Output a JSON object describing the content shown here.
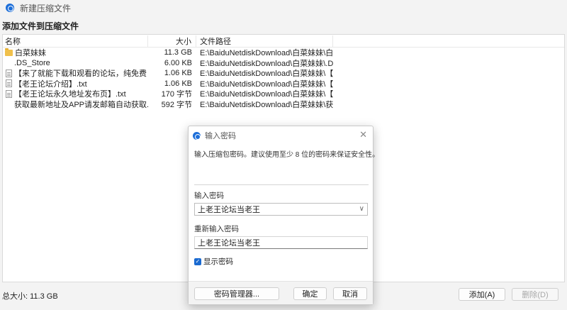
{
  "window": {
    "title": "新建压缩文件"
  },
  "section_title": "添加文件到压缩文件",
  "file_list": {
    "headers": {
      "name": "名称",
      "size": "大小",
      "path": "文件路径"
    },
    "rows": [
      {
        "icon": "folder-icon",
        "name": "白菜妹妹",
        "size": "11.3 GB",
        "path": "E:\\BaiduNetdiskDownload\\白菜妹妹\\白菜妹妹"
      },
      {
        "icon": "none",
        "name": ".DS_Store",
        "size": "6.00 KB",
        "path": "E:\\BaiduNetdiskDownload\\白菜妹妹\\.DS_Store"
      },
      {
        "icon": "text-file-icon",
        "name": "【来了就能下载和观看的论坛，纯免费！】.txt",
        "size": "1.06 KB",
        "path": "E:\\BaiduNetdiskDownload\\白菜妹妹\\【来了就..."
      },
      {
        "icon": "text-file-icon",
        "name": "【老王论坛介绍】.txt",
        "size": "1.06 KB",
        "path": "E:\\BaiduNetdiskDownload\\白菜妹妹\\【老王论..."
      },
      {
        "icon": "text-file-icon",
        "name": "【老王论坛永久地址发布页】.txt",
        "size": "170 字节",
        "path": "E:\\BaiduNetdiskDownload\\白菜妹妹\\【老王论..."
      },
      {
        "icon": "none",
        "name": "获取最新地址及APP请发邮箱自动获取.txt",
        "size": "592 字节",
        "path": "E:\\BaiduNetdiskDownload\\白菜妹妹\\获取最新..."
      }
    ]
  },
  "status": {
    "total_size": "总大小: 11.3 GB"
  },
  "buttons": {
    "add": "添加(A)",
    "delete": "删除(D)"
  },
  "password_dialog": {
    "title": "输入密码",
    "close_glyph": "✕",
    "description": "输入压缩包密码。建议使用至少 8 位的密码来保证安全性。",
    "password_label": "输入密码",
    "password_value": "上老王论坛当老王",
    "confirm_label": "重新输入密码",
    "confirm_value": "上老王论坛当老王",
    "show_password_label": "显示密码",
    "show_password_checked": true,
    "manager_button": "密码管理器...",
    "ok_button": "确定",
    "cancel_button": "取消"
  },
  "colors": {
    "accent": "#1a6ad0",
    "folder": "#f0c04b"
  }
}
